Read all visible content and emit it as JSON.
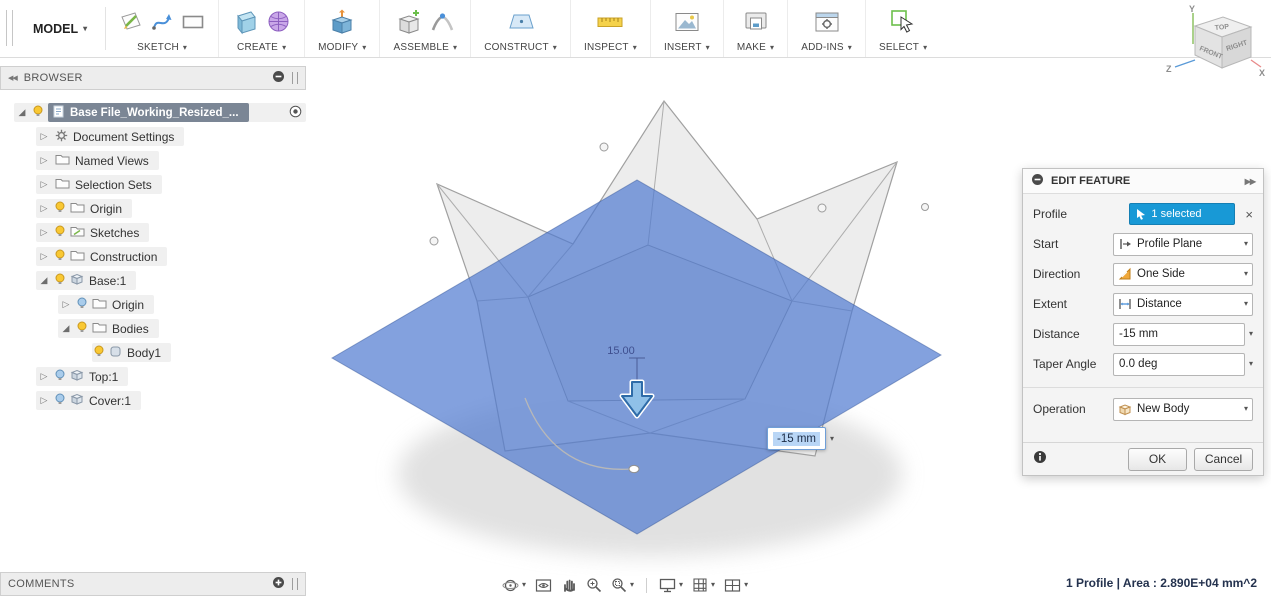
{
  "colors": {
    "accent_blue": "#1899d6",
    "selection_plane_blue": "#4f79d0",
    "selected_row_gray": "#7b8695"
  },
  "toolbar": {
    "workspace_label": "MODEL",
    "groups": [
      {
        "label": "SKETCH"
      },
      {
        "label": "CREATE"
      },
      {
        "label": "MODIFY"
      },
      {
        "label": "ASSEMBLE"
      },
      {
        "label": "CONSTRUCT"
      },
      {
        "label": "INSPECT"
      },
      {
        "label": "INSERT"
      },
      {
        "label": "MAKE"
      },
      {
        "label": "ADD-INS"
      },
      {
        "label": "SELECT"
      }
    ]
  },
  "viewcube": {
    "faces": {
      "top": "TOP",
      "front": "FRONT",
      "right": "RIGHT"
    },
    "axes": {
      "x": "X",
      "y": "Y",
      "z": "Z"
    }
  },
  "browser": {
    "title": "BROWSER",
    "items": [
      {
        "label": "Base File_Working_Resized_..."
      },
      {
        "label": "Document Settings"
      },
      {
        "label": "Named Views"
      },
      {
        "label": "Selection Sets"
      },
      {
        "label": "Origin"
      },
      {
        "label": "Sketches"
      },
      {
        "label": "Construction"
      },
      {
        "label": "Base:1"
      },
      {
        "label": "Origin"
      },
      {
        "label": "Bodies"
      },
      {
        "label": "Body1"
      },
      {
        "label": "Top:1"
      },
      {
        "label": "Cover:1"
      }
    ]
  },
  "canvas": {
    "dimension_label": "15.00",
    "distance_value": "-15 mm"
  },
  "edit_feature": {
    "title": "EDIT FEATURE",
    "rows": [
      {
        "label": "Profile",
        "value": "1 selected"
      },
      {
        "label": "Start",
        "value": "Profile Plane"
      },
      {
        "label": "Direction",
        "value": "One Side"
      },
      {
        "label": "Extent",
        "value": "Distance"
      },
      {
        "label": "Distance",
        "value": "-15 mm"
      },
      {
        "label": "Taper Angle",
        "value": "0.0 deg"
      },
      {
        "label": "Operation",
        "value": "New Body"
      }
    ],
    "ok_label": "OK",
    "cancel_label": "Cancel"
  },
  "comments": {
    "title": "COMMENTS"
  },
  "status_bar": {
    "text": "1 Profile | Area : 2.890E+04 mm^2"
  }
}
